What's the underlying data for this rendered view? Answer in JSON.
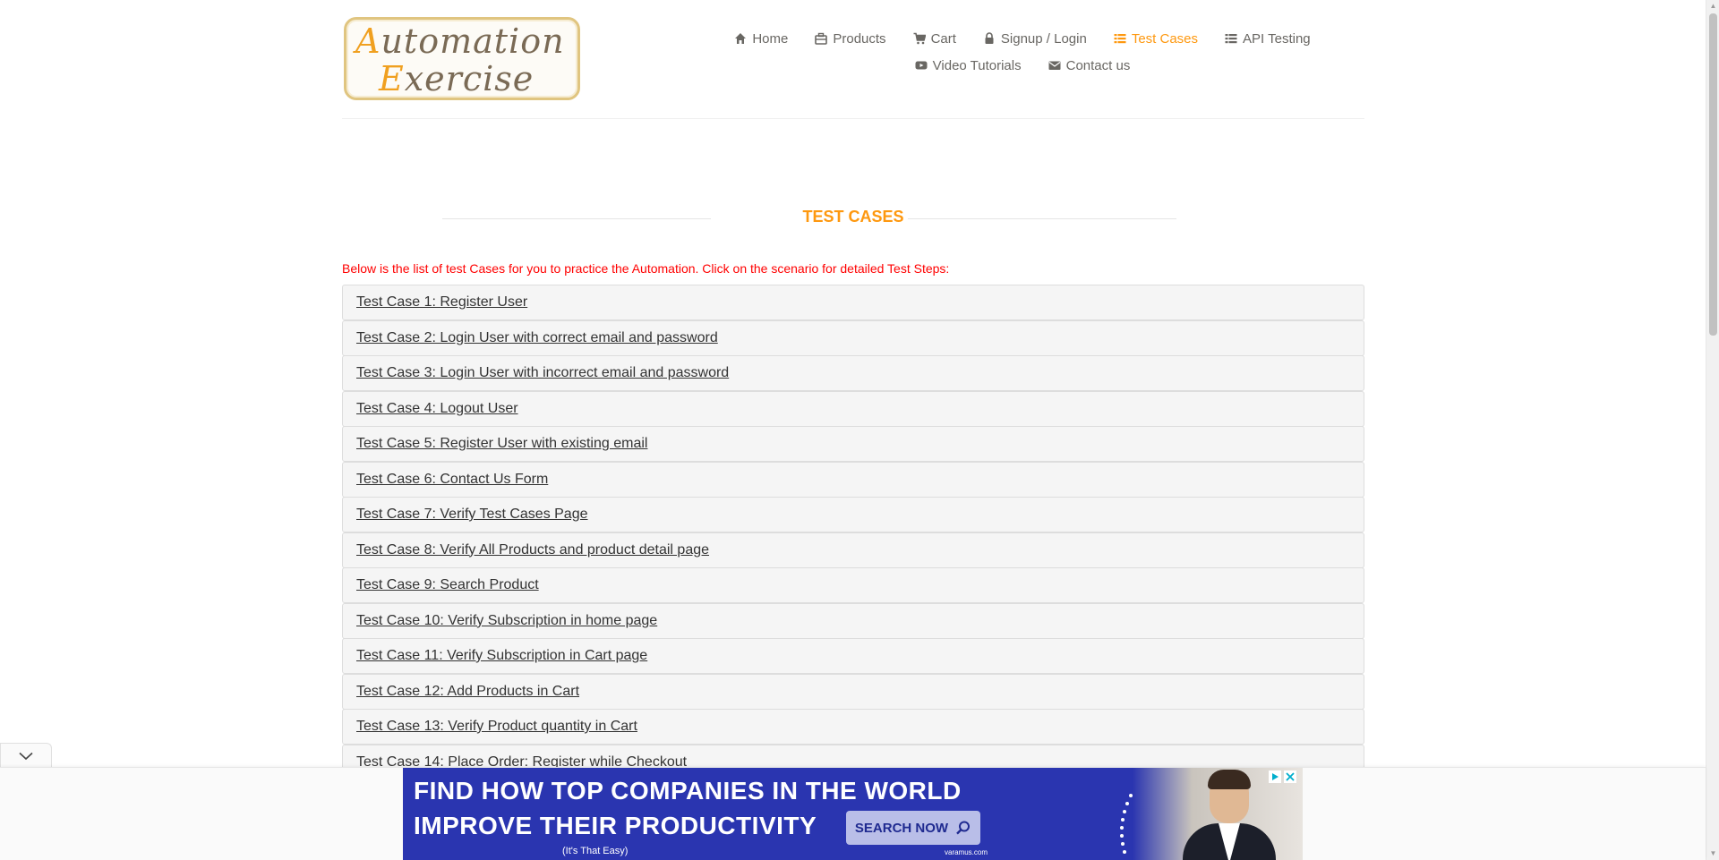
{
  "logo": {
    "line1_cap": "A",
    "line1_rest": "utomation",
    "line2_cap": "E",
    "line2_rest": "xercise"
  },
  "nav": {
    "row1": [
      {
        "label": "Home",
        "icon": "home-icon"
      },
      {
        "label": "Products",
        "icon": "products-icon"
      },
      {
        "label": "Cart",
        "icon": "cart-icon"
      },
      {
        "label": "Signup / Login",
        "icon": "lock-icon"
      },
      {
        "label": "Test Cases",
        "icon": "list-icon",
        "active": true
      },
      {
        "label": "API Testing",
        "icon": "list-icon"
      }
    ],
    "row2": [
      {
        "label": "Video Tutorials",
        "icon": "youtube-icon"
      },
      {
        "label": "Contact us",
        "icon": "envelope-icon"
      }
    ]
  },
  "page": {
    "title": "TEST CASES",
    "intro": "Below is the list of test Cases for you to practice the Automation. Click on the scenario for detailed Test Steps:"
  },
  "test_cases": [
    "Test Case 1: Register User",
    "Test Case 2: Login User with correct email and password",
    "Test Case 3: Login User with incorrect email and password",
    "Test Case 4: Logout User",
    "Test Case 5: Register User with existing email",
    "Test Case 6: Contact Us Form",
    "Test Case 7: Verify Test Cases Page",
    "Test Case 8: Verify All Products and product detail page",
    "Test Case 9: Search Product",
    "Test Case 10: Verify Subscription in home page",
    "Test Case 11: Verify Subscription in Cart page",
    "Test Case 12: Add Products in Cart",
    "Test Case 13: Verify Product quantity in Cart",
    "Test Case 14: Place Order: Register while Checkout"
  ],
  "ad": {
    "headline1": "FIND HOW TOP COMPANIES IN THE WORLD",
    "headline2": "IMPROVE THEIR PRODUCTIVITY",
    "tagline": "(It's That Easy)",
    "button": "SEARCH NOW",
    "brand": "varamus.com"
  },
  "colors": {
    "accent": "#fe980f",
    "intro_text": "#ff0000",
    "nav_text": "#696763",
    "ad_background": "#2a35b0"
  }
}
